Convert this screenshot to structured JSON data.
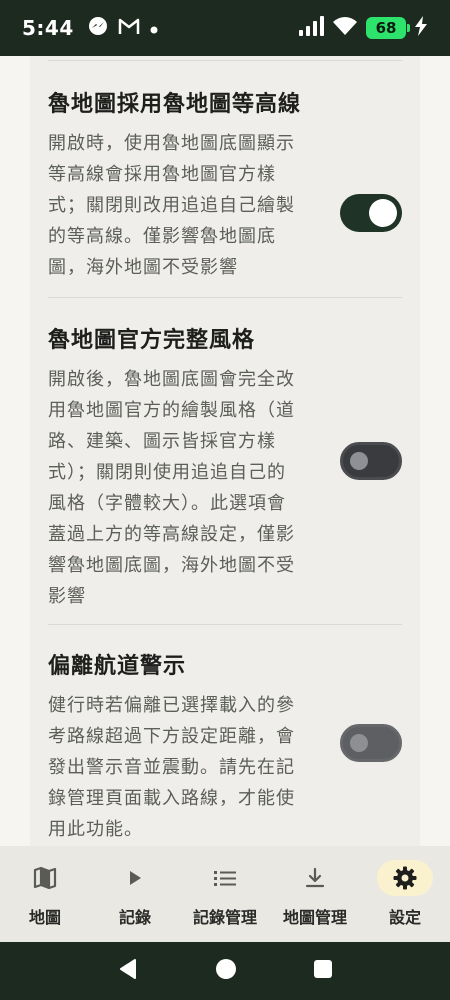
{
  "status_bar": {
    "time": "5:44",
    "battery": "68",
    "icons": [
      "messenger-icon",
      "gmail-icon",
      "dot-icon",
      "signal-icon",
      "wifi-icon",
      "battery-icon",
      "charging-icon"
    ]
  },
  "settings": [
    {
      "title": "魯地圖採用魯地圖等高線",
      "desc_lines": [
        "開啟時，使用魯地圖底圖顯示",
        "等高線會採用魯地圖官方樣",
        "式；關閉則改用追追自己繪製",
        "的等高線。僅影響魯地圖底",
        "圖，海外地圖不受影響"
      ],
      "toggle": "on"
    },
    {
      "title": "魯地圖官方完整風格",
      "desc_lines": [
        "開啟後，魯地圖底圖會完全改",
        "用魯地圖官方的繪製風格（道",
        "路、建築、圖示皆採官方樣",
        "式）；關閉則使用追追自己的",
        "風格（字體較大）。此選項會",
        "蓋過上方的等高線設定，僅影",
        "響魯地圖底圖，海外地圖不受",
        "影響"
      ],
      "toggle": "off"
    },
    {
      "title": "偏離航道警示",
      "desc_lines": [
        "健行時若偏離已選擇載入的參",
        "考路線超過下方設定距離，會",
        "發出警示音並震動。請先在記",
        "錄管理頁面載入路線，才能使",
        "用此功能。"
      ],
      "toggle": "disabled"
    }
  ],
  "bottom_nav": [
    {
      "label": "地圖",
      "icon": "map-icon"
    },
    {
      "label": "記錄",
      "icon": "play-icon"
    },
    {
      "label": "記錄管理",
      "icon": "list-icon"
    },
    {
      "label": "地圖管理",
      "icon": "download-icon"
    },
    {
      "label": "設定",
      "icon": "gear-icon",
      "active": true
    }
  ],
  "colors": {
    "status_bg": "#1d2a20",
    "toggle_on": "#1f3326",
    "active_nav_bg": "#faf1cf",
    "battery": "#2ee36b"
  }
}
